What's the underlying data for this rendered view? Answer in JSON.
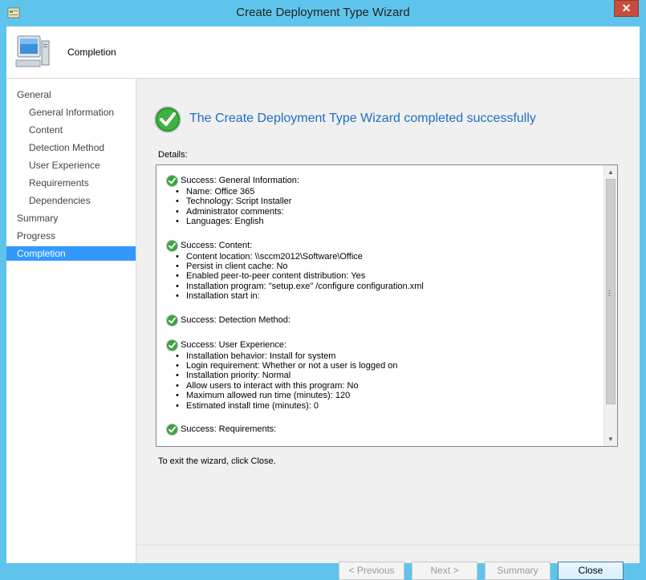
{
  "window": {
    "title": "Create Deployment Type Wizard",
    "close_glyph": "✕"
  },
  "header": {
    "title": "Completion",
    "icon": "computer-icon"
  },
  "nav": {
    "items": [
      {
        "label": "General",
        "level": "top"
      },
      {
        "label": "General Information",
        "level": "sub"
      },
      {
        "label": "Content",
        "level": "sub"
      },
      {
        "label": "Detection Method",
        "level": "sub"
      },
      {
        "label": "User Experience",
        "level": "sub"
      },
      {
        "label": "Requirements",
        "level": "sub"
      },
      {
        "label": "Dependencies",
        "level": "sub"
      },
      {
        "label": "Summary",
        "level": "top"
      },
      {
        "label": "Progress",
        "level": "top"
      },
      {
        "label": "Completion",
        "level": "top",
        "active": true
      }
    ],
    "active_color": "#3399ff"
  },
  "main": {
    "heading": "The Create Deployment Type Wizard completed successfully",
    "heading_color": "#1e6fc1",
    "details_label": "Details:",
    "exit_text": "To exit the wizard, click Close."
  },
  "details": {
    "sections": [
      {
        "title": "Success: General Information:",
        "items": [
          "Name: Office 365",
          "Technology: Script Installer",
          "Administrator comments:",
          "Languages: English"
        ]
      },
      {
        "title": "Success: Content:",
        "items": [
          "Content location: \\\\sccm2012\\Software\\Office",
          "Persist in client cache: No",
          "Enabled peer-to-peer content distribution: Yes",
          "Installation program: \"setup.exe\"  /configure configuration.xml",
          "Installation start in:"
        ]
      },
      {
        "title": "Success: Detection Method:",
        "items": []
      },
      {
        "title": "Success: User Experience:",
        "items": [
          "Installation behavior: Install for system",
          "Login requirement: Whether or not a user is logged on",
          "Installation priority: Normal",
          "Allow users to interact with this program: No",
          "Maximum allowed run time (minutes): 120",
          "Estimated install time (minutes): 0"
        ]
      },
      {
        "title": "Success: Requirements:",
        "items": []
      }
    ]
  },
  "buttons": {
    "previous": "< Previous",
    "next": "Next >",
    "summary": "Summary",
    "close": "Close"
  }
}
